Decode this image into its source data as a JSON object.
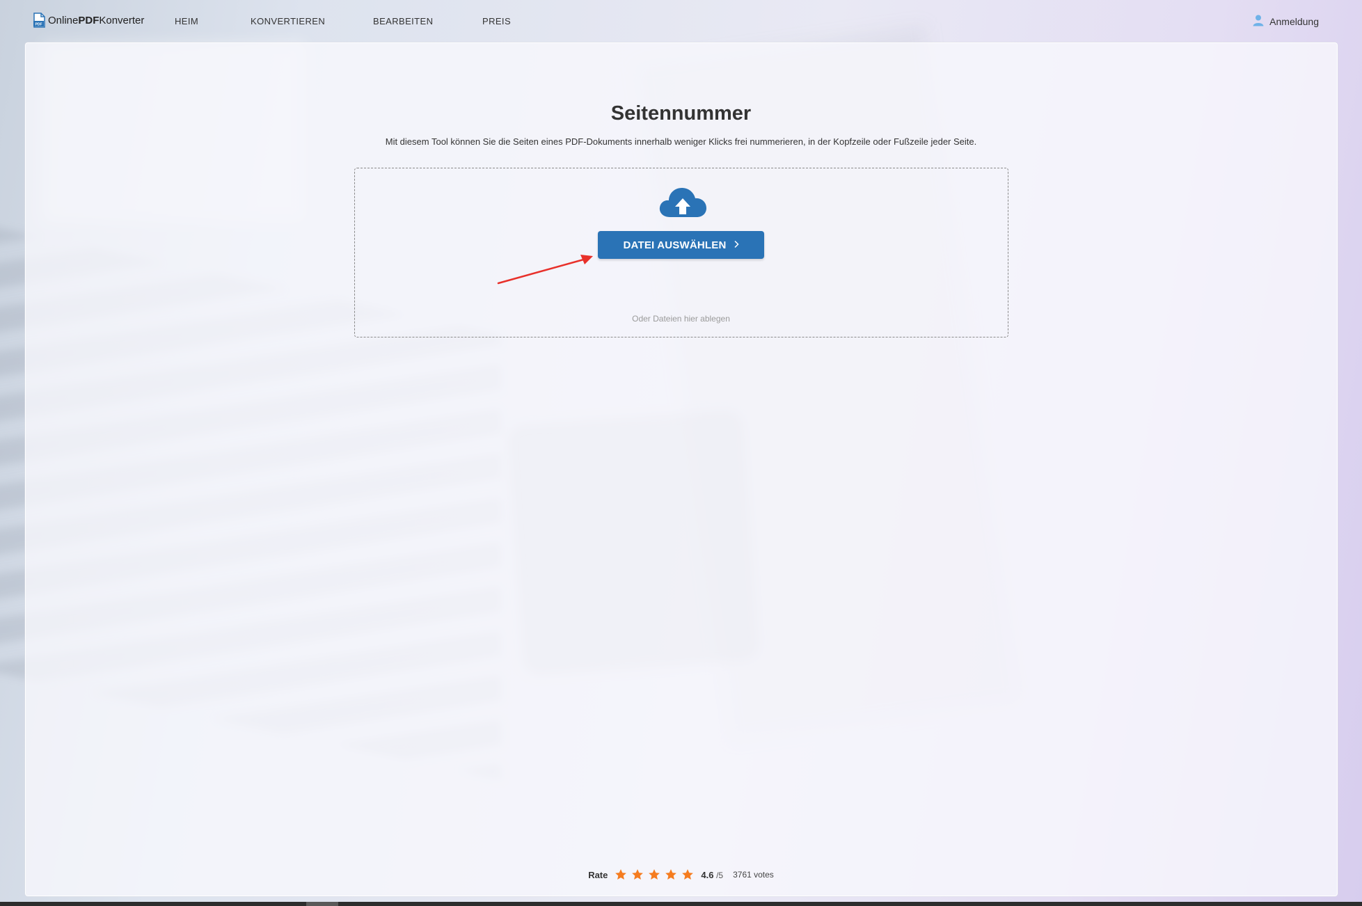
{
  "nav": {
    "logo": {
      "prefix": "Online",
      "bold": "PDF",
      "suffix": "Konverter"
    },
    "links": [
      "HEIM",
      "KONVERTIEREN",
      "BEARBEITEN",
      "PREIS"
    ],
    "login_label": "Anmeldung"
  },
  "main": {
    "title": "Seitennummer",
    "subtitle": "Mit diesem Tool können Sie die Seiten eines PDF-Dokuments innerhalb weniger Klicks frei nummerieren, in der Kopfzeile oder Fußzeile jeder Seite.",
    "button_label": "DATEI AUSWÄHLEN",
    "drop_hint": "Oder Dateien hier ablegen"
  },
  "rating": {
    "label": "Rate",
    "stars_filled": 5,
    "score": "4.6",
    "max": "/5",
    "votes": "3761 votes"
  },
  "colors": {
    "accent": "#2a73b6",
    "star": "#f57c1f",
    "annotation_arrow": "#e8302a"
  },
  "icons": [
    "pdf-logo-icon",
    "user-icon",
    "cloud-upload-icon",
    "chevron-right-icon",
    "star-icon"
  ]
}
